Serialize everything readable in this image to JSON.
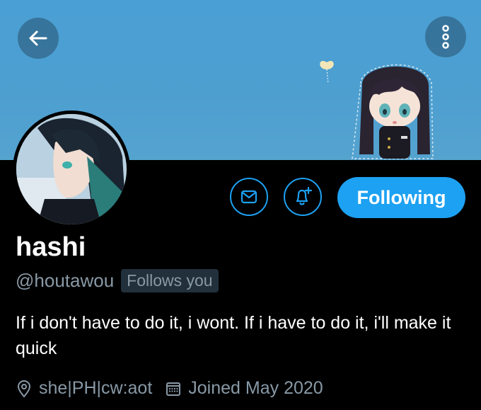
{
  "header": {
    "back_icon": "arrow-left-icon",
    "more_icon": "more-vertical-icon"
  },
  "profile": {
    "name": "hashi",
    "handle": "@houtawou",
    "follows_you_badge": "Follows you",
    "bio": "If i don't have to do it, i wont. If i have to do it, i'll make it quick",
    "location": "she|PH|cw:aot",
    "joined": "Joined May 2020"
  },
  "actions": {
    "message_icon": "envelope-icon",
    "notify_icon": "bell-plus-icon",
    "follow_label": "Following"
  },
  "colors": {
    "accent": "#1da1f2",
    "background": "#000000",
    "banner": "#4a9fd4",
    "muted_text": "#8899a6"
  }
}
